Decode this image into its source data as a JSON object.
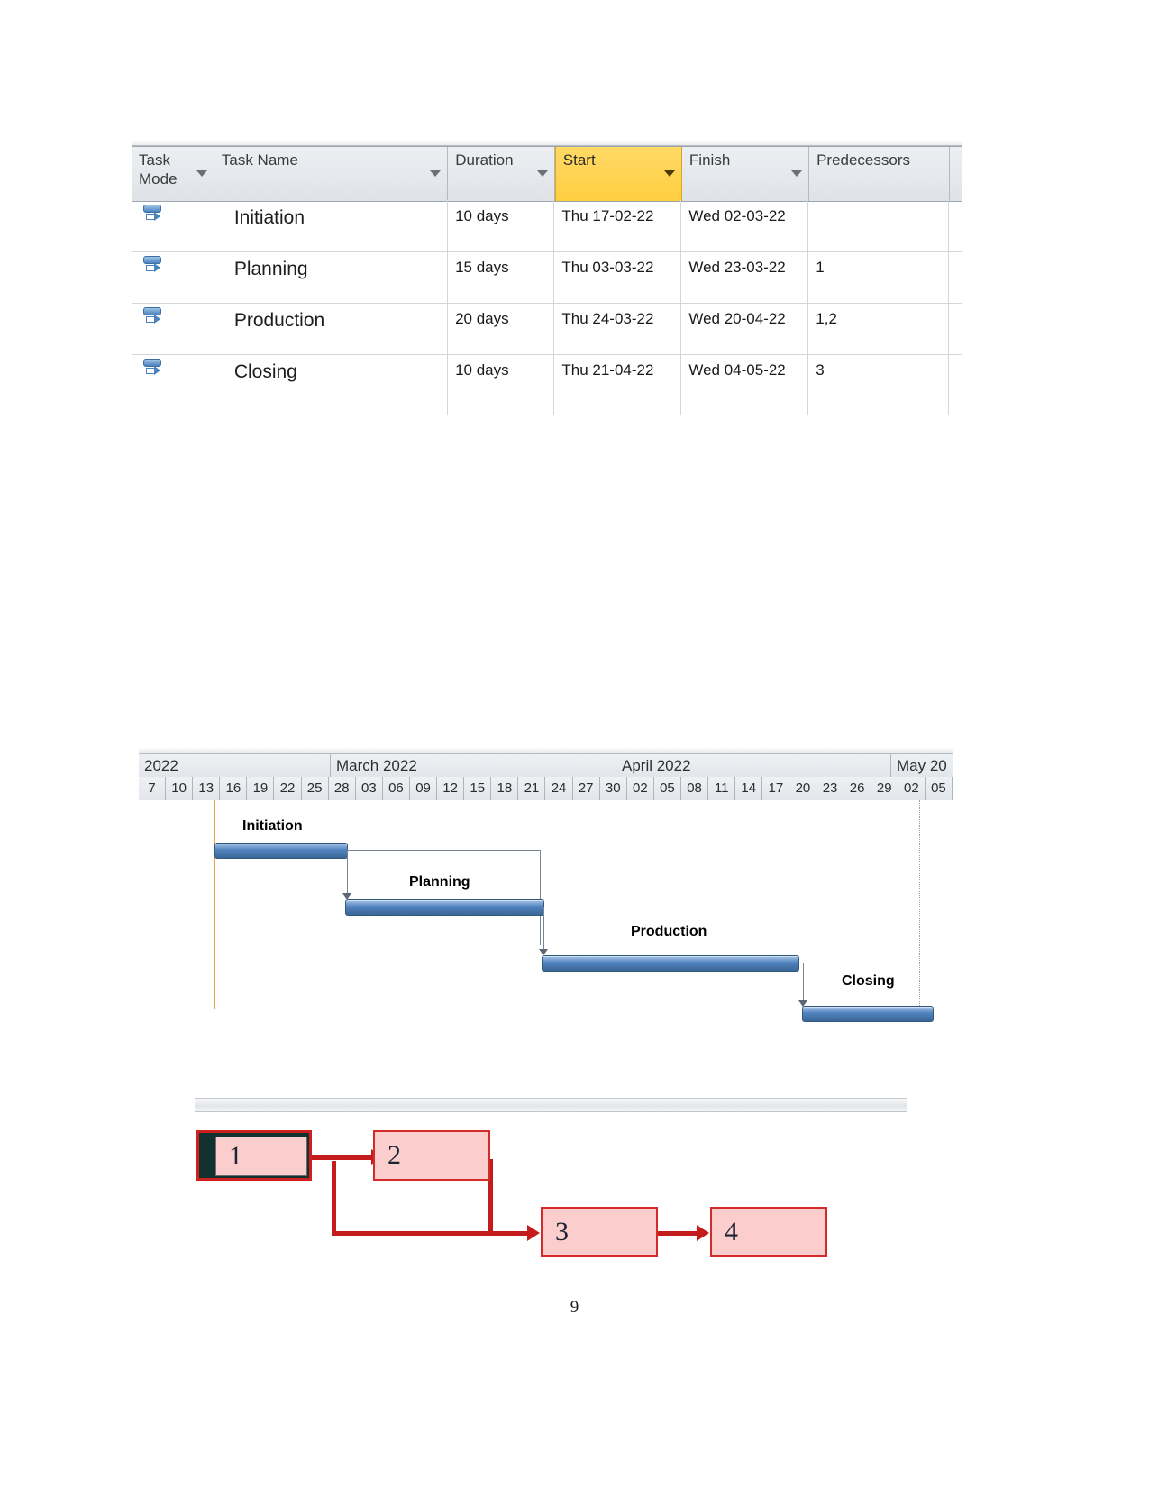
{
  "task_table": {
    "columns": [
      {
        "label": "Task Mode",
        "selected": false,
        "has_filter": true
      },
      {
        "label": "Task Name",
        "selected": false,
        "has_filter": true
      },
      {
        "label": "Duration",
        "selected": false,
        "has_filter": true
      },
      {
        "label": "Start",
        "selected": true,
        "has_filter": true
      },
      {
        "label": "Finish",
        "selected": false,
        "has_filter": true
      },
      {
        "label": "Predecessors",
        "selected": false,
        "has_filter": true
      }
    ],
    "selected_column_color": "#ffd24d",
    "rows": [
      {
        "mode_icon": "manually-scheduled-icon",
        "name": "Initiation",
        "duration": "10 days",
        "start": "Thu 17-02-22",
        "finish": "Wed 02-03-22",
        "predecessors": ""
      },
      {
        "mode_icon": "manually-scheduled-icon",
        "name": "Planning",
        "duration": "15 days",
        "start": "Thu 03-03-22",
        "finish": "Wed 23-03-22",
        "predecessors": "1"
      },
      {
        "mode_icon": "manually-scheduled-icon",
        "name": "Production",
        "duration": "20 days",
        "start": "Thu 24-03-22",
        "finish": "Wed 20-04-22",
        "predecessors": "1,2"
      },
      {
        "mode_icon": "manually-scheduled-icon",
        "name": "Closing",
        "duration": "10 days",
        "start": "Thu 21-04-22",
        "finish": "Wed 04-05-22",
        "predecessors": "3"
      }
    ]
  },
  "chart_data": {
    "type": "bar",
    "chart_kind": "gantt",
    "title": "",
    "xlabel": "",
    "ylabel": "",
    "grid": false,
    "legend": "none",
    "months": [
      {
        "label": "2022",
        "start_day": "07",
        "span_ticks": 4
      },
      {
        "label": "March 2022",
        "start_day": "28",
        "span_ticks": 11
      },
      {
        "label": "April 2022",
        "start_day": "30",
        "span_ticks": 10
      },
      {
        "label": "May 20",
        "start_day": "02",
        "span_ticks": 2
      }
    ],
    "day_ticks": [
      "7",
      "10",
      "13",
      "16",
      "19",
      "22",
      "25",
      "28",
      "03",
      "06",
      "09",
      "12",
      "15",
      "18",
      "21",
      "24",
      "27",
      "30",
      "02",
      "05",
      "08",
      "11",
      "14",
      "17",
      "20",
      "23",
      "26",
      "29",
      "02",
      "05"
    ],
    "tasks": [
      {
        "name": "Initiation",
        "start": "Thu 17-02-22",
        "finish": "Wed 02-03-22",
        "duration_days": 10,
        "bar_start_tick": 3.2,
        "bar_end_tick": 8.1,
        "color": "#4f81bd"
      },
      {
        "name": "Planning",
        "start": "Thu 03-03-22",
        "finish": "Wed 23-03-22",
        "duration_days": 15,
        "bar_start_tick": 8.1,
        "bar_end_tick": 15.3,
        "color": "#4f81bd"
      },
      {
        "name": "Production",
        "start": "Thu 24-03-22",
        "finish": "Wed 20-04-22",
        "duration_days": 20,
        "bar_start_tick": 15.3,
        "bar_end_tick": 24.7,
        "color": "#4f81bd"
      },
      {
        "name": "Closing",
        "start": "Thu 21-04-22",
        "finish": "Wed 04-05-22",
        "duration_days": 10,
        "bar_start_tick": 24.7,
        "bar_end_tick": 29.5,
        "color": "#4f81bd"
      }
    ],
    "links": [
      {
        "from": "Initiation",
        "to": "Planning",
        "type": "finish-to-start"
      },
      {
        "from": "Initiation",
        "to": "Production",
        "type": "finish-to-start"
      },
      {
        "from": "Planning",
        "to": "Production",
        "type": "finish-to-start"
      },
      {
        "from": "Production",
        "to": "Closing",
        "type": "finish-to-start"
      }
    ]
  },
  "network_diagram": {
    "node_fill": "#fbcdcd",
    "node_border": "#d42a2a",
    "edge_color": "#c41c1c",
    "selected_frame": "#123232",
    "nodes": [
      {
        "id": "1",
        "label": "1",
        "selected": true
      },
      {
        "id": "2",
        "label": "2",
        "selected": false
      },
      {
        "id": "3",
        "label": "3",
        "selected": false
      },
      {
        "id": "4",
        "label": "4",
        "selected": false
      }
    ],
    "edges": [
      {
        "from": "1",
        "to": "2"
      },
      {
        "from": "1",
        "to": "3"
      },
      {
        "from": "2",
        "to": "3"
      },
      {
        "from": "3",
        "to": "4"
      }
    ]
  },
  "footer": {
    "page_number": "9"
  }
}
